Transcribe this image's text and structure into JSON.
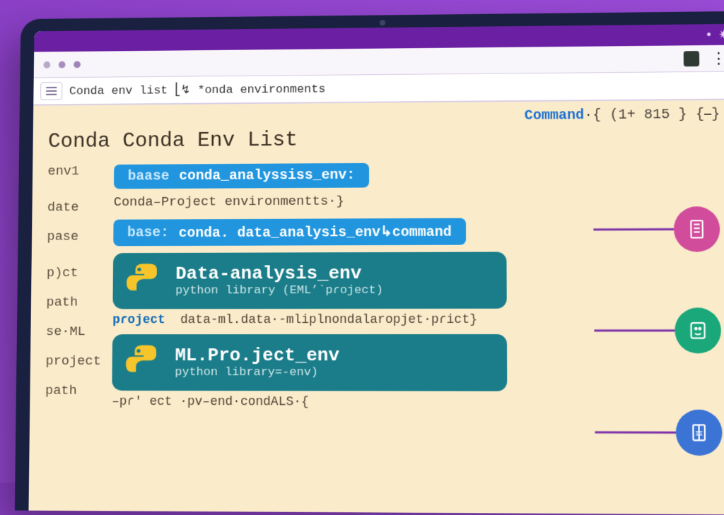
{
  "titlebar": {
    "star": "✷",
    "dot": "•"
  },
  "urlbar": {
    "text": "Conda env list ⎣↯ *onda environments"
  },
  "command_label": {
    "word": "Command",
    "rest": "·{  (1+ 815 }   {⎯}"
  },
  "page_title": "Conda Conda Env List",
  "sidebar": {
    "items": [
      "env1",
      "date",
      "pase",
      "p)ct",
      "path",
      "se·ML",
      "project",
      "path"
    ]
  },
  "pill1": {
    "label": "baase",
    "value": "conda_analyssiss_env:"
  },
  "sub1": "Conda–Project environmentts·}",
  "pill2": {
    "label": "base:",
    "value": "conda. data_analysis_env↳command"
  },
  "card1": {
    "title": "Data-analysis_env",
    "sub": "python library (EML’`pɾoject)"
  },
  "interline": {
    "lead": "pɾoject",
    "rest": "data-ml.data·-mliplnondalaropjet·pɾict}"
  },
  "card2": {
    "title": "ML.Pro.ject_env",
    "sub": "python library=-env)"
  },
  "footer": "–pɾ' ect ·pv–end·condALS·{"
}
